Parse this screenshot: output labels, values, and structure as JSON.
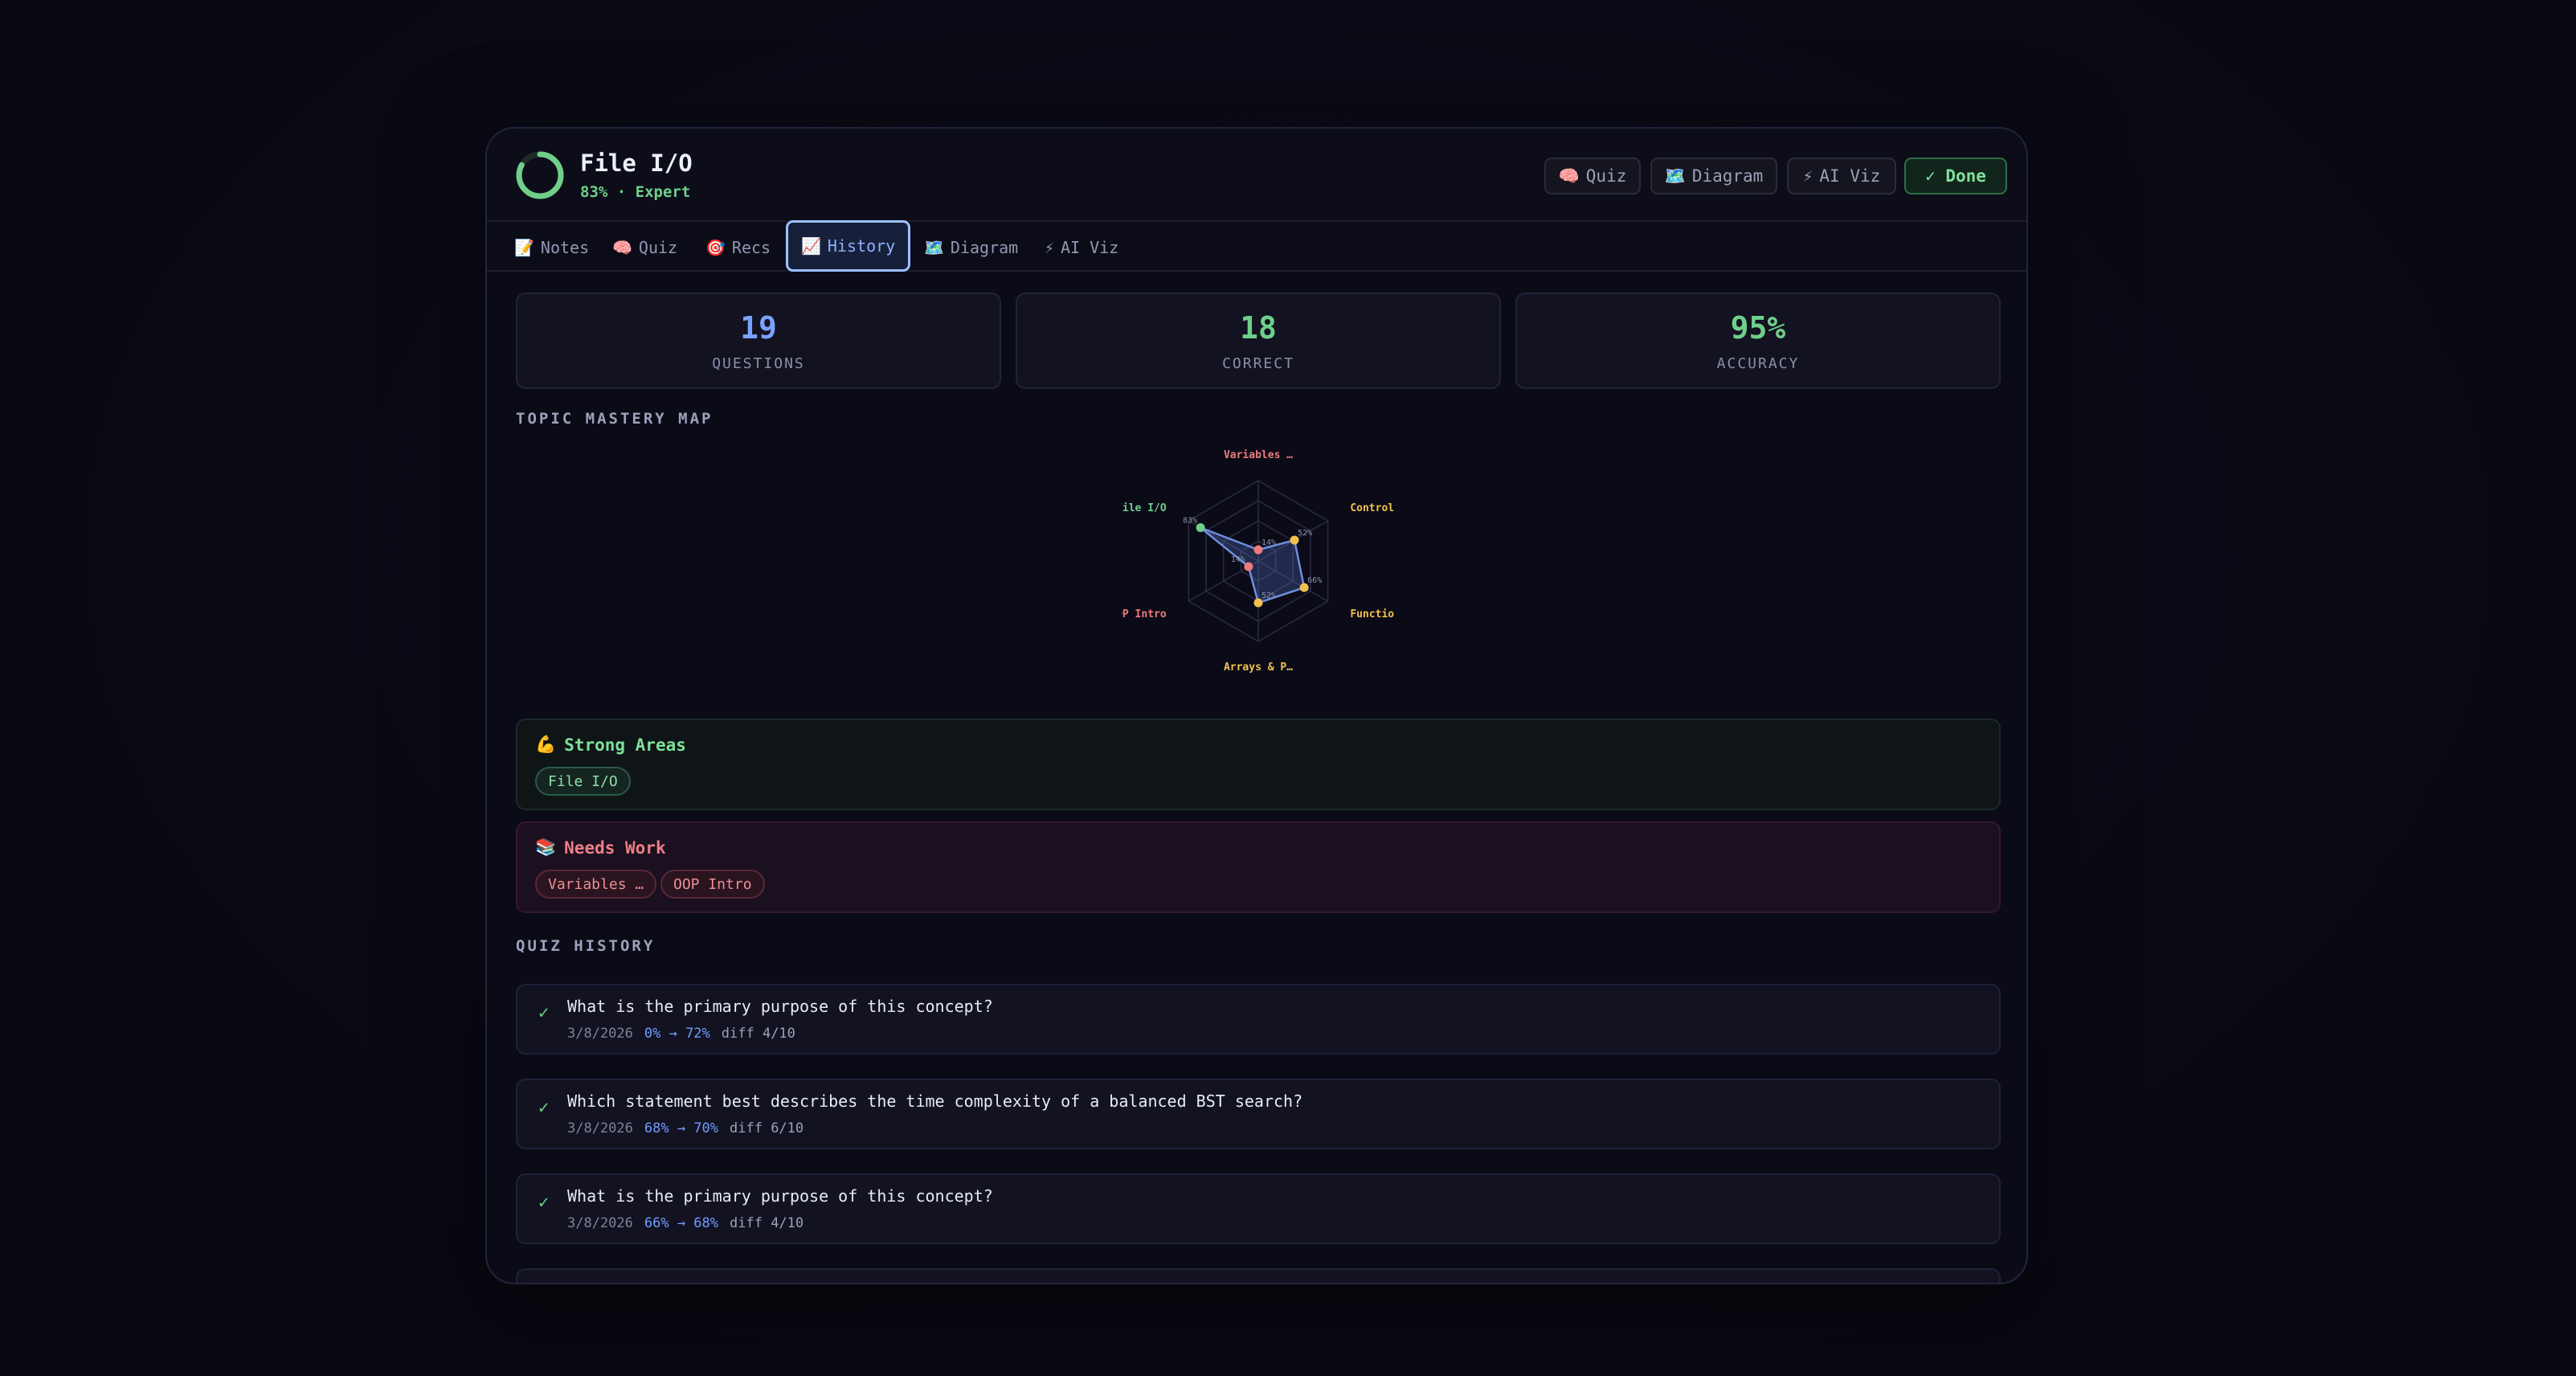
{
  "header": {
    "title": "File I/O",
    "subtitle": "83% · Expert",
    "progress": 0.83,
    "buttons": {
      "quiz": "Quiz",
      "diagram": "Diagram",
      "ai_viz": "AI Viz",
      "done": "✓ Done"
    },
    "button_icons": {
      "quiz": "🧠",
      "diagram": "🗺️",
      "ai_viz": "⚡"
    }
  },
  "tabs": [
    {
      "icon": "📝",
      "label": "Notes"
    },
    {
      "icon": "🧠",
      "label": "Quiz"
    },
    {
      "icon": "🎯",
      "label": "Recs"
    },
    {
      "icon": "📈",
      "label": "History"
    },
    {
      "icon": "🗺️",
      "label": "Diagram"
    },
    {
      "icon": "⚡",
      "label": "AI Viz"
    }
  ],
  "active_tab": "History",
  "stats": [
    {
      "value": "19",
      "label": "QUESTIONS",
      "color": "#7aa2ff"
    },
    {
      "value": "18",
      "label": "CORRECT",
      "color": "#6fcf8a"
    },
    {
      "value": "95%",
      "label": "ACCURACY",
      "color": "#6fcf8a"
    }
  ],
  "mastery": {
    "title": "TOPIC MASTERY MAP",
    "topics": [
      {
        "name": "Variables …",
        "value": 14,
        "value_label": "14%",
        "color": "#ee7b7b"
      },
      {
        "name": "Control Fl",
        "value": 52,
        "value_label": "52%",
        "color": "#f2c14e"
      },
      {
        "name": "Functions",
        "value": 66,
        "value_label": "66%",
        "color": "#f2c14e"
      },
      {
        "name": "Arrays & P…",
        "value": 52,
        "value_label": "52%",
        "color": "#f2c14e"
      },
      {
        "name": "OP Intro",
        "value": 14,
        "value_label": "14%",
        "color": "#ee7b7b"
      },
      {
        "name": "File I/O",
        "value": 83,
        "value_label": "83%",
        "color": "#6fcf8a"
      }
    ]
  },
  "strong_areas": {
    "icon": "💪",
    "title": "Strong Areas",
    "items": [
      "File I/O"
    ]
  },
  "needs_work": {
    "icon": "📚",
    "title": "Needs Work",
    "items": [
      "Variables …",
      "OOP Intro"
    ]
  },
  "history": {
    "title": "QUIZ HISTORY",
    "items": [
      {
        "question": "What is the primary purpose of this concept?",
        "date": "3/8/2026",
        "delta": "0% → 72%",
        "diff": "diff 4/10"
      },
      {
        "question": "Which statement best describes the time complexity of a balanced BST search?",
        "date": "3/8/2026",
        "delta": "68% → 70%",
        "diff": "diff 6/10"
      },
      {
        "question": "What is the primary purpose of this concept?",
        "date": "3/8/2026",
        "delta": "66% → 68%",
        "diff": "diff 4/10"
      }
    ]
  }
}
